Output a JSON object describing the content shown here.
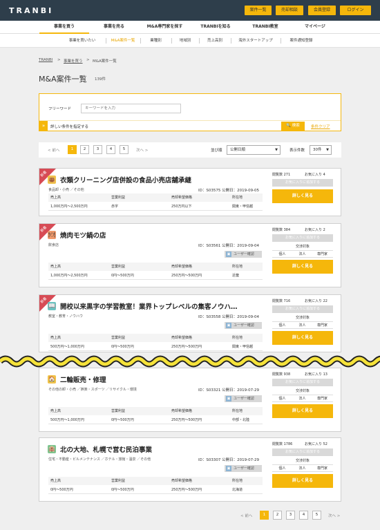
{
  "header": {
    "logo": "TRANBI",
    "buttons": [
      "案件一覧",
      "売却相談",
      "会員登録",
      "ログイン"
    ]
  },
  "nav": {
    "items": [
      "事業を買う",
      "事業を売る",
      "M&A専門家を探す",
      "TRANBIを知る",
      "TRANBI教室",
      "マイページ"
    ]
  },
  "subnav": {
    "items": [
      "事業を買いたい",
      "M&A案件一覧",
      "業種別",
      "地域別",
      "売上高別",
      "海外スタートアップ",
      "案件通知登録"
    ]
  },
  "breadcrumb": {
    "items": [
      "TRANBI",
      ">",
      "事業を買う",
      ">",
      "M&A案件一覧"
    ]
  },
  "page": {
    "title": "M&A案件一覧",
    "count": "139件"
  },
  "search": {
    "label": "フリーワード",
    "placeholder": "キーワードを入力",
    "expand_label": "詳しい条件を指定する",
    "expand_icon": "»",
    "search_button": "🔍 検索",
    "clear_link": "条件クリア"
  },
  "pager": {
    "prev": "< 前へ",
    "next": "次へ >",
    "pages": [
      "1",
      "2",
      "3",
      "4",
      "5"
    ],
    "sort_label": "並び順",
    "sort_value": "公開日順",
    "per_page_label": "表示件数",
    "per_page_value": "30件"
  },
  "table_headers": [
    "売上高",
    "営業利益",
    "売却希望価格",
    "所在地"
  ],
  "labels": {
    "views": "閲覧数",
    "favs": "お気に入り",
    "add_fav": "お気に入りに追加する",
    "transaction_target": "交渉対象",
    "trans_types": [
      "個人",
      "法人",
      "専門家"
    ],
    "detail": "詳しく見る",
    "new": "新着"
  },
  "listings": [
    {
      "title": "衣類クリーニング店併設の食品小売店舗承継",
      "categories": "食品卸・小売 ／その他",
      "id_date": "ID：S03575 公開日：2019-09-05",
      "icon": "👜",
      "is_new": true,
      "views": "閲覧数 271",
      "favs": "お気に入り 4",
      "user_tag": null,
      "values": [
        "1,000万円〜2,500万円",
        "赤字",
        "250万円以下",
        "関東・甲信越"
      ]
    },
    {
      "title": "焼肉モツ鍋の店",
      "categories": "飲食店",
      "id_date": "ID：S03561 公開日：2019-09-04",
      "icon": "🍽",
      "is_new": true,
      "views": "閲覧数 384",
      "favs": "お気に入り 2",
      "user_tag": "ユーザー確認",
      "values": [
        "1,000万円〜2,500万円",
        "0円〜500万円",
        "250万円〜500万円",
        "近畿"
      ]
    },
    {
      "title": "開校以来黒字の学習教室！業界トップレベルの集客ノウハ…",
      "categories": "教室・教育・ノウハウ",
      "id_date": "ID：S03558 公開日：2019-09-04",
      "icon": "📖",
      "is_new": true,
      "views": "閲覧数 716",
      "favs": "お気に入り 22",
      "user_tag": "ユーザー確認",
      "values": [
        "500万円〜1,000万円",
        "0円〜500万円",
        "250万円〜500万円",
        "関東・甲信越"
      ]
    },
    {
      "title": "二輪販売・修理",
      "categories": "その他の卸・小売 ／娯楽・スポーツ ／リサイクル・環境",
      "id_date": "ID：S03321 公開日：2019-07-29",
      "icon": "🏠",
      "is_new": false,
      "views": "閲覧数 938",
      "favs": "お気に入り 13",
      "user_tag": "ユーザー確認",
      "values": [
        "500万円〜1,000万円",
        "0円〜500万円",
        "250万円〜500万円",
        "中部・北陸"
      ]
    },
    {
      "title": "北の大地、札幌で営む民泊事業",
      "categories": "住宅・不動産・ビルメンテナンス ／ホテル・旅館・温泉 ／その他",
      "id_date": "ID：S03307 公開日：2019-07-29",
      "icon": "🏨",
      "is_new": false,
      "views": "閲覧数 1786",
      "favs": "お気に入り 52",
      "user_tag": "ユーザー確認",
      "values": [
        "0円〜500万円",
        "0円〜500万円",
        "250万円〜500万円",
        "北海道"
      ]
    }
  ],
  "colors": {
    "accent": "#f5b70b",
    "topbar": "#2e3e4b",
    "ribbon": "#d74b55"
  }
}
